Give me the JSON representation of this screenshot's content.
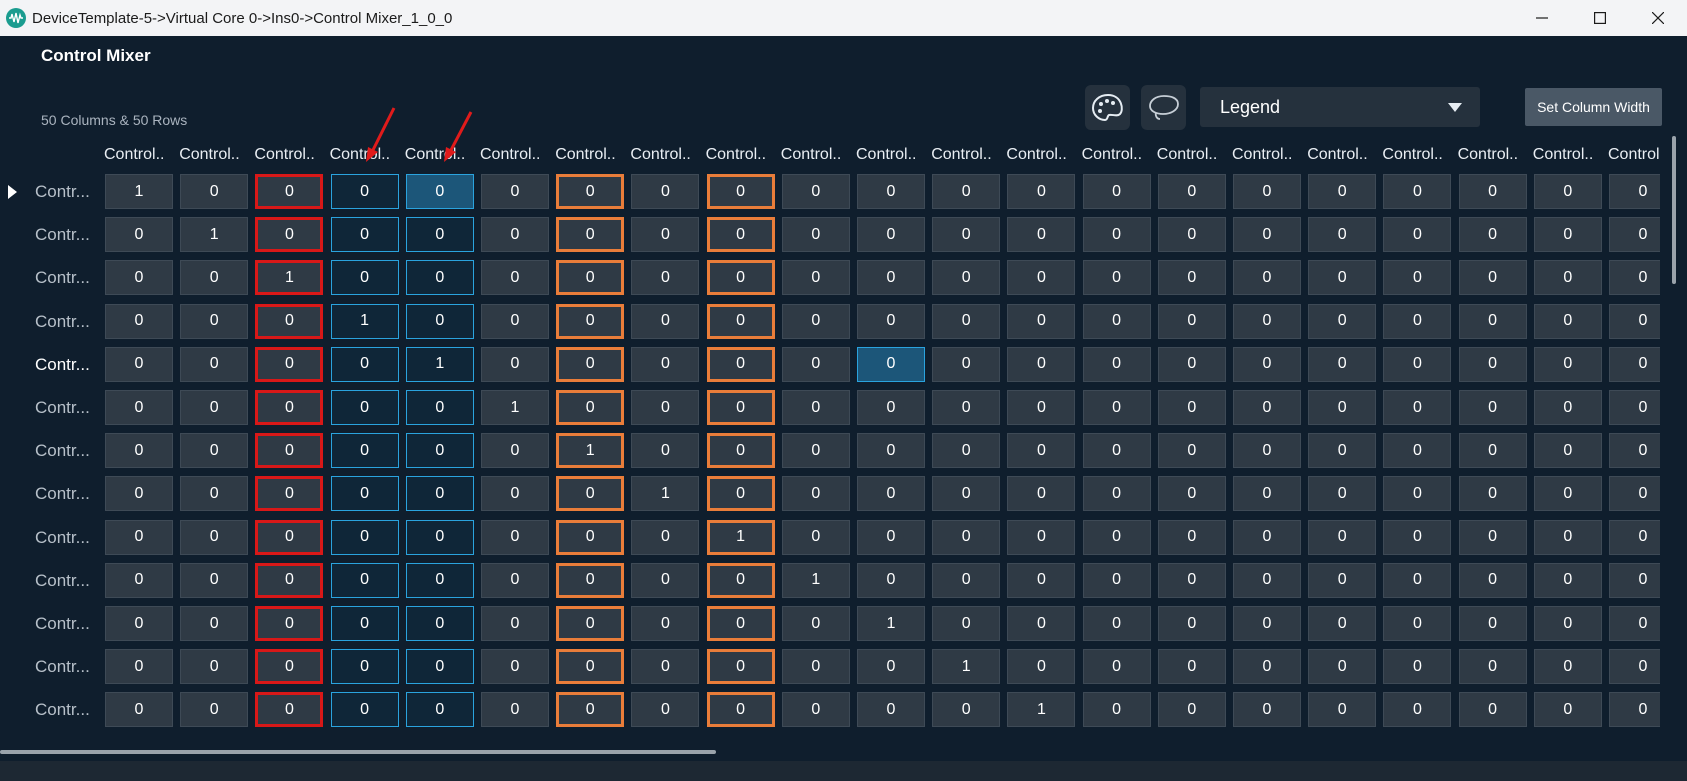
{
  "window": {
    "title": "DeviceTemplate-5->Virtual Core 0->Ins0->Control Mixer_1_0_0",
    "app_icon": "waveform-icon",
    "controls": [
      "minimize-icon",
      "maximize-icon",
      "close-icon"
    ]
  },
  "header": {
    "title": "Control Mixer",
    "subtitle": "50 Columns & 50 Rows"
  },
  "toolbar": {
    "palette_icon": "palette-icon",
    "lasso_icon": "lasso-icon",
    "legend_value": "Legend",
    "set_column_width_label": "Set Column Width"
  },
  "grid": {
    "column_labels": [
      "Control..",
      "Control..",
      "Control..",
      "Control..",
      "Control..",
      "Control..",
      "Control..",
      "Control..",
      "Control..",
      "Control..",
      "Control..",
      "Control..",
      "Control..",
      "Control..",
      "Control..",
      "Control..",
      "Control..",
      "Control..",
      "Control..",
      "Control..",
      "Control"
    ],
    "row_labels": [
      "Contr...",
      "Contr...",
      "Contr...",
      "Contr...",
      "Contr...",
      "Contr...",
      "Contr...",
      "Contr...",
      "Contr...",
      "Contr...",
      "Contr...",
      "Contr...",
      "Contr..."
    ],
    "current_row": 0,
    "active_row": 4,
    "red_columns": [
      2
    ],
    "orange_columns": [
      6,
      8
    ],
    "blue_columns": [
      3,
      4
    ],
    "selected_cells": [
      [
        0,
        4
      ],
      [
        4,
        10
      ]
    ],
    "highlight_colors": {
      "red": "#d81818",
      "orange": "#e97d3a",
      "blue": "#2aa3de",
      "selected": "#1c5679"
    },
    "values": [
      [
        "1",
        "0",
        "0",
        "0",
        "0",
        "0",
        "0",
        "0",
        "0",
        "0",
        "0",
        "0",
        "0",
        "0",
        "0",
        "0",
        "0",
        "0",
        "0",
        "0",
        "0"
      ],
      [
        "0",
        "1",
        "0",
        "0",
        "0",
        "0",
        "0",
        "0",
        "0",
        "0",
        "0",
        "0",
        "0",
        "0",
        "0",
        "0",
        "0",
        "0",
        "0",
        "0",
        "0"
      ],
      [
        "0",
        "0",
        "1",
        "0",
        "0",
        "0",
        "0",
        "0",
        "0",
        "0",
        "0",
        "0",
        "0",
        "0",
        "0",
        "0",
        "0",
        "0",
        "0",
        "0",
        "0"
      ],
      [
        "0",
        "0",
        "0",
        "1",
        "0",
        "0",
        "0",
        "0",
        "0",
        "0",
        "0",
        "0",
        "0",
        "0",
        "0",
        "0",
        "0",
        "0",
        "0",
        "0",
        "0"
      ],
      [
        "0",
        "0",
        "0",
        "0",
        "1",
        "0",
        "0",
        "0",
        "0",
        "0",
        "0",
        "0",
        "0",
        "0",
        "0",
        "0",
        "0",
        "0",
        "0",
        "0",
        "0"
      ],
      [
        "0",
        "0",
        "0",
        "0",
        "0",
        "1",
        "0",
        "0",
        "0",
        "0",
        "0",
        "0",
        "0",
        "0",
        "0",
        "0",
        "0",
        "0",
        "0",
        "0",
        "0"
      ],
      [
        "0",
        "0",
        "0",
        "0",
        "0",
        "0",
        "1",
        "0",
        "0",
        "0",
        "0",
        "0",
        "0",
        "0",
        "0",
        "0",
        "0",
        "0",
        "0",
        "0",
        "0"
      ],
      [
        "0",
        "0",
        "0",
        "0",
        "0",
        "0",
        "0",
        "1",
        "0",
        "0",
        "0",
        "0",
        "0",
        "0",
        "0",
        "0",
        "0",
        "0",
        "0",
        "0",
        "0"
      ],
      [
        "0",
        "0",
        "0",
        "0",
        "0",
        "0",
        "0",
        "0",
        "1",
        "0",
        "0",
        "0",
        "0",
        "0",
        "0",
        "0",
        "0",
        "0",
        "0",
        "0",
        "0"
      ],
      [
        "0",
        "0",
        "0",
        "0",
        "0",
        "0",
        "0",
        "0",
        "0",
        "1",
        "0",
        "0",
        "0",
        "0",
        "0",
        "0",
        "0",
        "0",
        "0",
        "0",
        "0"
      ],
      [
        "0",
        "0",
        "0",
        "0",
        "0",
        "0",
        "0",
        "0",
        "0",
        "0",
        "1",
        "0",
        "0",
        "0",
        "0",
        "0",
        "0",
        "0",
        "0",
        "0",
        "0"
      ],
      [
        "0",
        "0",
        "0",
        "0",
        "0",
        "0",
        "0",
        "0",
        "0",
        "0",
        "0",
        "1",
        "0",
        "0",
        "0",
        "0",
        "0",
        "0",
        "0",
        "0",
        "0"
      ],
      [
        "0",
        "0",
        "0",
        "0",
        "0",
        "0",
        "0",
        "0",
        "0",
        "0",
        "0",
        "0",
        "1",
        "0",
        "0",
        "0",
        "0",
        "0",
        "0",
        "0",
        "0"
      ]
    ]
  }
}
